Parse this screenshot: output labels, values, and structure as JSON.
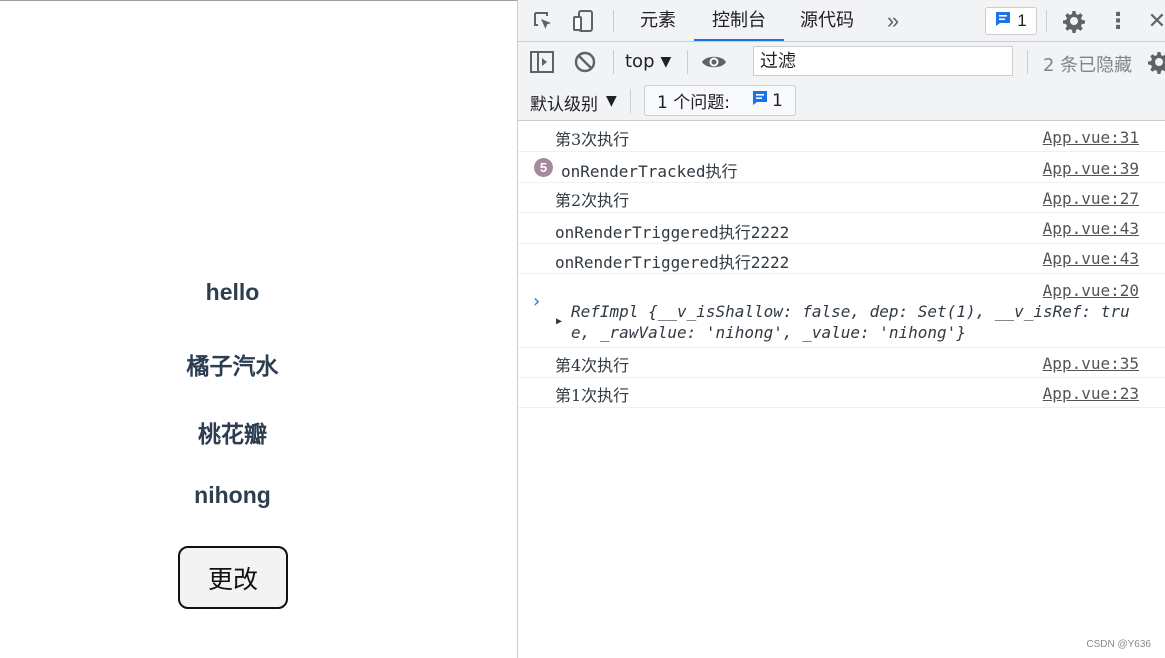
{
  "app": {
    "lines": [
      "hello",
      "橘子汽水",
      "桃花瓣",
      "nihong"
    ],
    "button_label": "更改"
  },
  "devtools": {
    "tabs": [
      {
        "label": "元素",
        "active": false
      },
      {
        "label": "控制台",
        "active": true
      },
      {
        "label": "源代码",
        "active": false
      }
    ],
    "more_tabs_icon": "chevron-double-right-icon",
    "issues_badge_count": "1",
    "toolbar": {
      "context": "top",
      "filter_placeholder": "过滤",
      "hidden_count": "2 条已隐藏"
    },
    "toolbar2": {
      "levels_label": "默认级别",
      "issues_label": "1 个问题:",
      "issues_count": "1"
    },
    "console": [
      {
        "message": "第3次执行",
        "source": "App.vue:31"
      },
      {
        "count": "5",
        "message": "onRenderTracked执行",
        "source": "App.vue:39"
      },
      {
        "message": "第2次执行",
        "source": "App.vue:27"
      },
      {
        "message": "onRenderTriggered执行2222",
        "source": "App.vue:43"
      },
      {
        "message": "onRenderTriggered执行2222",
        "source": "App.vue:43"
      },
      {
        "source": "App.vue:20",
        "object_line1": "RefImpl {__v_isShallow: false, dep: Set(1), __v_isRef: tru",
        "object_line2": "e, _rawValue: 'nihong', _value: 'nihong'}"
      },
      {
        "message": "第4次执行",
        "source": "App.vue:35"
      },
      {
        "message": "第1次执行",
        "source": "App.vue:23"
      }
    ],
    "prompt_symbol": "›"
  },
  "watermark": "CSDN @Y636",
  "colors": {
    "accent": "#1a73e8",
    "app_text": "#2c3e50",
    "count_badge": "#a6899b"
  }
}
